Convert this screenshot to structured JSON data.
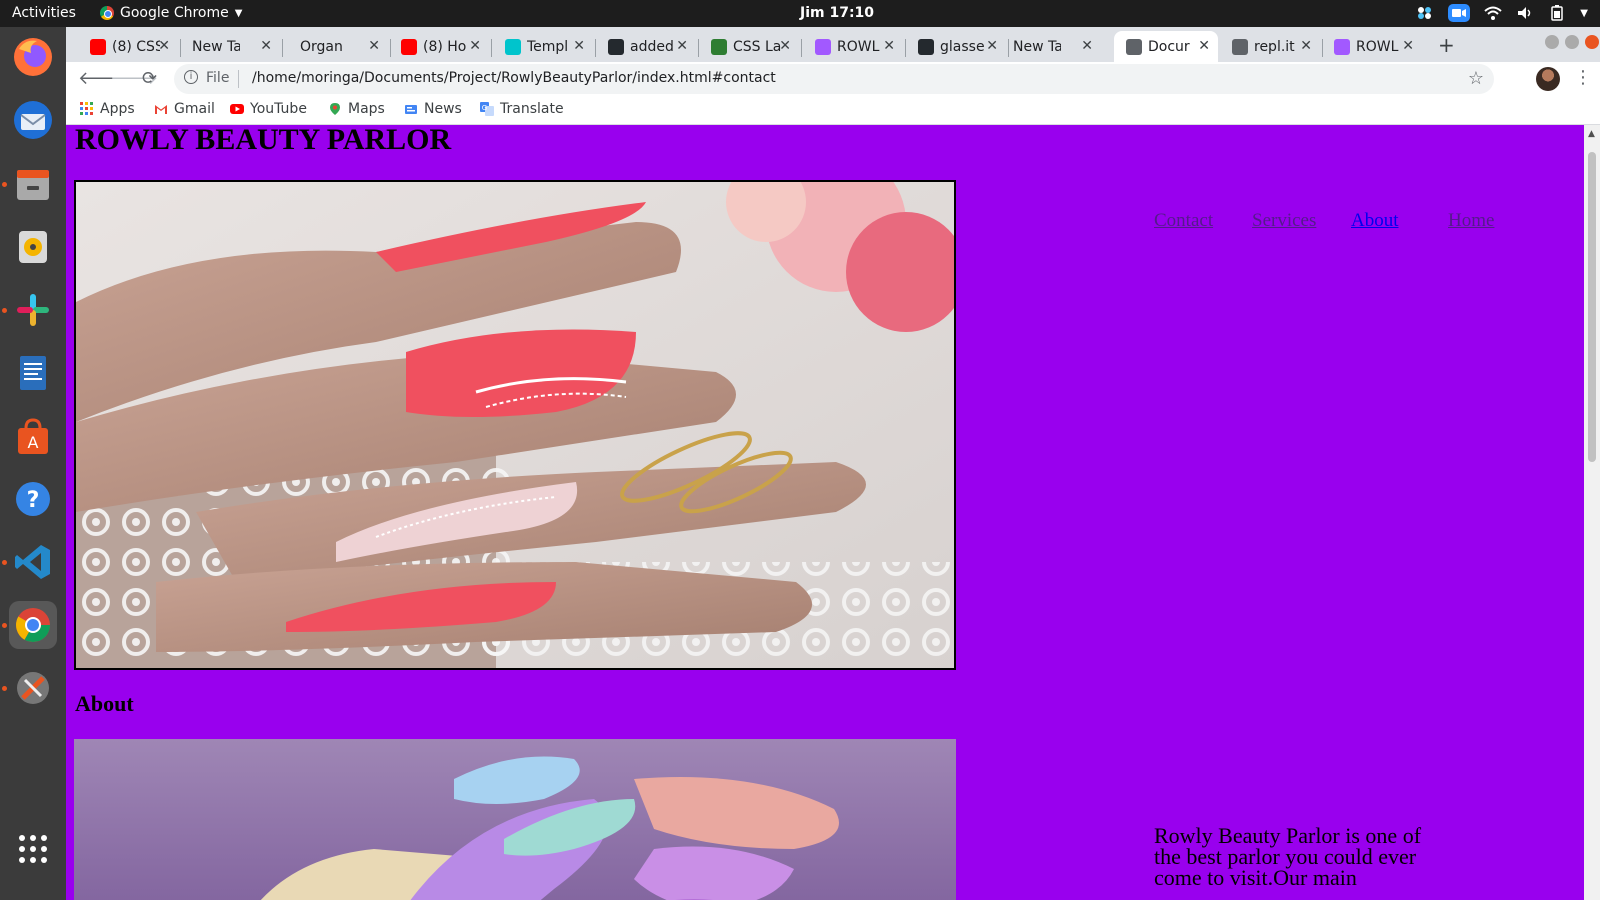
{
  "system_bar": {
    "activities": "Activities",
    "app_name": "Google Chrome",
    "clock": "Jim 17:10"
  },
  "tabs": [
    {
      "title": "(8) CSS",
      "favicon": "youtube-icon"
    },
    {
      "title": "New Tab",
      "favicon": "none"
    },
    {
      "title": "Organ",
      "favicon": "none"
    },
    {
      "title": "(8) Ho",
      "favicon": "youtube-icon"
    },
    {
      "title": "Templ",
      "favicon": "canva-icon"
    },
    {
      "title": "added",
      "favicon": "github-icon"
    },
    {
      "title": "CSS La",
      "favicon": "codepen-icon"
    },
    {
      "title": "ROWL",
      "favicon": "figma-icon"
    },
    {
      "title": "glasse",
      "favicon": "github-icon"
    },
    {
      "title": "New Tab",
      "favicon": "none"
    },
    {
      "title": "Docur",
      "favicon": "globe-icon",
      "active": true
    },
    {
      "title": "repl.it",
      "favicon": "replit-icon"
    },
    {
      "title": "ROWL",
      "favicon": "figma-icon"
    }
  ],
  "address_bar": {
    "scheme_label": "File",
    "url": "/home/moringa/Documents/Project/RowlyBeautyParlor/index.html#contact"
  },
  "bookmarks": [
    {
      "label": "Apps",
      "icon": "apps-grid-icon"
    },
    {
      "label": "Gmail",
      "icon": "gmail-icon"
    },
    {
      "label": "YouTube",
      "icon": "youtube-icon"
    },
    {
      "label": "Maps",
      "icon": "maps-icon"
    },
    {
      "label": "News",
      "icon": "news-icon"
    },
    {
      "label": "Translate",
      "icon": "translate-icon"
    }
  ],
  "page": {
    "background": "#9900ee",
    "title": "ROWLY BEAUTY PARLOR",
    "nav": [
      {
        "label": "Contact",
        "color": "#551a8b"
      },
      {
        "label": "Services",
        "color": "#551a8b"
      },
      {
        "label": "About",
        "color": "#0000ee"
      },
      {
        "label": "Home",
        "color": "#551a8b"
      }
    ],
    "about_heading": "About",
    "about_text": "Rowly Beauty Parlor is one of the best parlor you could ever come to visit.Our main"
  }
}
